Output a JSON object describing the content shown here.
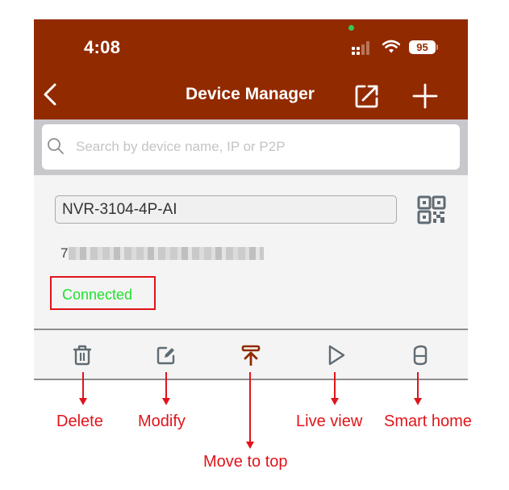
{
  "status_bar": {
    "time": "4:08",
    "battery": "95",
    "icons": [
      "camera-indicator-icon",
      "cellular-signal-icon",
      "wifi-icon",
      "battery-icon"
    ]
  },
  "header": {
    "title": "Device Manager",
    "back_icon": "chevron-left-icon",
    "share_icon": "share-external-icon",
    "add_icon": "plus-icon"
  },
  "search": {
    "placeholder": "Search by device name, IP or P2P",
    "value": "",
    "icon": "search-icon"
  },
  "device": {
    "name": "NVR-3104-4P-AI",
    "id_visible_prefix": "7",
    "id_obscured": true,
    "status": "Connected",
    "qr_icon": "qr-code-icon"
  },
  "toolbar": {
    "items": [
      {
        "icon": "trash-icon",
        "label": "Delete"
      },
      {
        "icon": "edit-icon",
        "label": "Modify"
      },
      {
        "icon": "move-to-top-icon",
        "label": "Move to top"
      },
      {
        "icon": "play-icon",
        "label": "Live view"
      },
      {
        "icon": "smart-speaker-icon",
        "label": "Smart home"
      }
    ]
  },
  "annotations": {
    "delete": "Delete",
    "modify": "Modify",
    "move_to_top": "Move to top",
    "live_view": "Live view",
    "smart_home": "Smart home"
  },
  "colors": {
    "header_bg": "#922a00",
    "accent_icon": "#922a00",
    "status_connected": "#1fe12e",
    "annotation_red": "#e0141b",
    "icon_gray": "#5f6b73"
  }
}
